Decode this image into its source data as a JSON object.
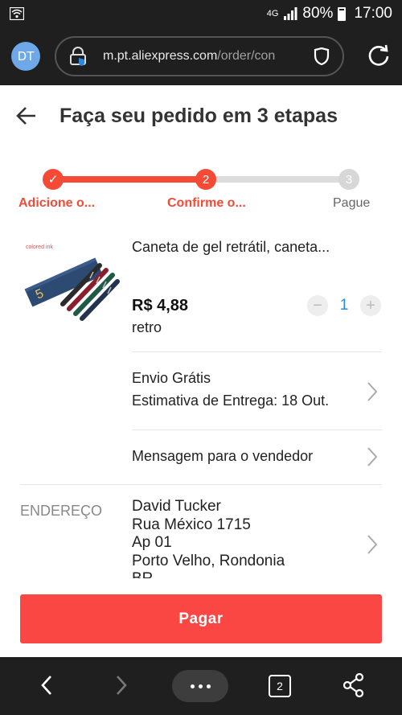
{
  "status_bar": {
    "network": "4G",
    "battery": "80%",
    "time": "17:00",
    "icons": [
      "wifi-icon",
      "signal-icon",
      "battery-icon"
    ]
  },
  "browser": {
    "avatar_initials": "DT",
    "url_host": "m.pt.aliexpress.com",
    "url_path": "/order/con",
    "icons": [
      "lock-icon",
      "shield-icon",
      "reload-icon"
    ]
  },
  "header": {
    "title": "Faça seu pedido em 3 etapas",
    "back_icon": "back-arrow-icon"
  },
  "stepper": {
    "progress": 0.5,
    "steps": [
      {
        "label": "Adicione o...",
        "marker": "✓",
        "state": "done"
      },
      {
        "label": "Confirme o...",
        "marker": "2",
        "state": "current"
      },
      {
        "label": "Pague",
        "marker": "3",
        "state": "pending"
      }
    ]
  },
  "product": {
    "image_caption": "colored ink",
    "title": "Caneta de gel retrátil, caneta...",
    "price": "R$ 4,88",
    "variant": "retro",
    "quantity": "1",
    "minus": "−",
    "plus": "+"
  },
  "shipping": {
    "line1": "Envio Grátis",
    "line2": "Estimativa de Entrega: 18 Out."
  },
  "message": {
    "label": "Mensagem para o vendedor"
  },
  "address": {
    "label": "ENDEREÇO",
    "lines": [
      "David Tucker",
      "Rua México 1715",
      "Ap 01",
      "Porto Velho, Rondonia",
      "BR"
    ]
  },
  "pay_button": "Pagar",
  "nav": {
    "tabs_count": "2",
    "icons": [
      "nav-back-icon",
      "nav-forward-icon",
      "menu-dots-icon",
      "tabs-icon",
      "share-icon"
    ]
  },
  "colors": {
    "accent": "#f54a35",
    "pay": "#fb4744",
    "qty_value": "#2a8bd6",
    "bars": "#1f1f1f"
  }
}
